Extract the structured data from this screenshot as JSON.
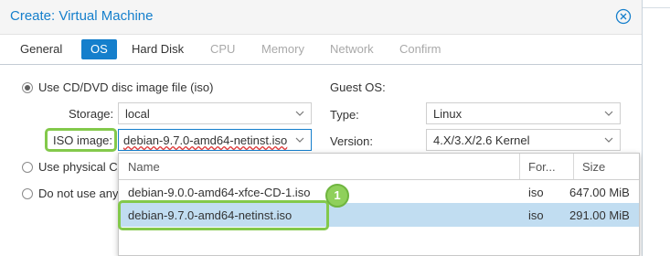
{
  "dialog": {
    "title": "Create: Virtual Machine",
    "close_icon": "close-icon"
  },
  "tabs": [
    {
      "label": "General",
      "state": "enabled"
    },
    {
      "label": "OS",
      "state": "active"
    },
    {
      "label": "Hard Disk",
      "state": "enabled"
    },
    {
      "label": "CPU",
      "state": "disabled"
    },
    {
      "label": "Memory",
      "state": "disabled"
    },
    {
      "label": "Network",
      "state": "disabled"
    },
    {
      "label": "Confirm",
      "state": "disabled"
    }
  ],
  "media": {
    "use_iso_label": "Use CD/DVD disc image file (iso)",
    "use_physical_label": "Use physical C",
    "no_media_label": "Do not use any",
    "storage_label": "Storage:",
    "storage_value": "local",
    "iso_label": "ISO image:",
    "iso_value": "debian-9.7.0-amd64-netinst.iso"
  },
  "guest": {
    "heading": "Guest OS:",
    "type_label": "Type:",
    "type_value": "Linux",
    "version_label": "Version:",
    "version_value": "4.X/3.X/2.6 Kernel"
  },
  "iso_dropdown": {
    "columns": [
      "Name",
      "For...",
      "Size"
    ],
    "rows": [
      {
        "name": "debian-9.0.0-amd64-xfce-CD-1.iso",
        "format": "iso",
        "size": "647.00 MiB"
      },
      {
        "name": "debian-9.7.0-amd64-netinst.iso",
        "format": "iso",
        "size": "291.00 MiB",
        "selected": true
      }
    ]
  },
  "annotation": {
    "step": "1",
    "color": "#8fd05b"
  },
  "colors": {
    "accent": "#157fcc",
    "highlight": "#83c94b",
    "selected_row": "#c1ddf1"
  }
}
